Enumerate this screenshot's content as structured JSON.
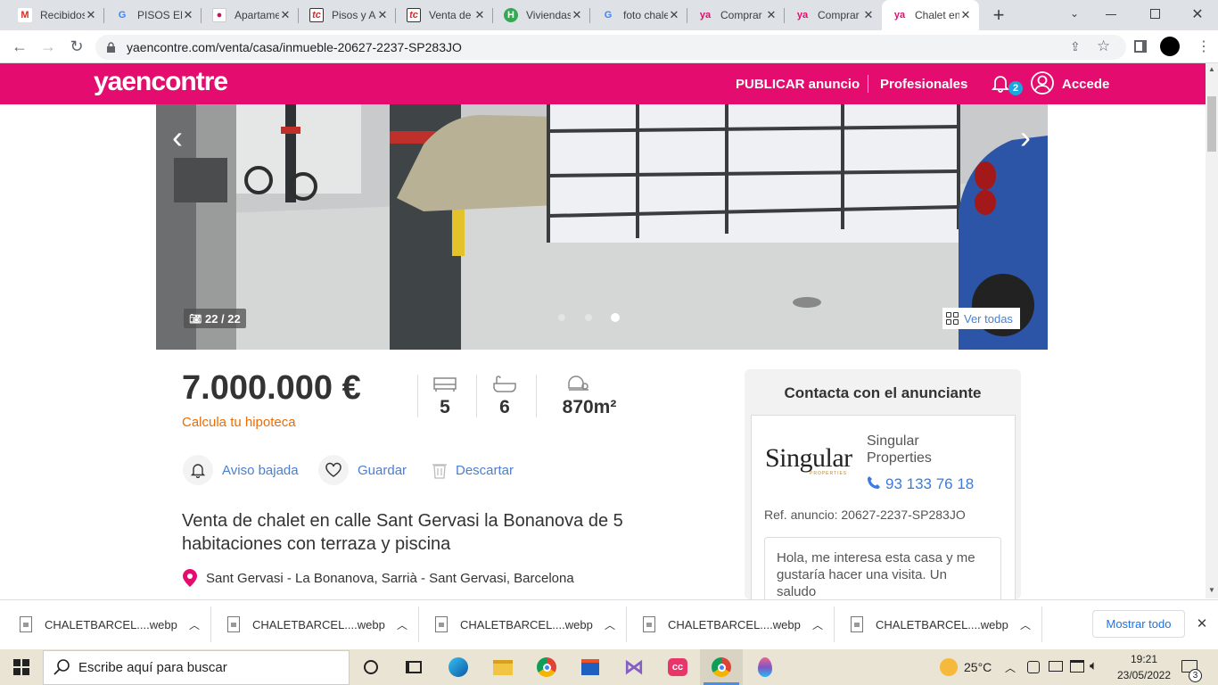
{
  "browser": {
    "tabs": [
      {
        "title": "Recibidos",
        "icon": "gmail-icon"
      },
      {
        "title": "PISOS EN",
        "icon": "google-icon"
      },
      {
        "title": "Apartamentos",
        "icon": "site-icon"
      },
      {
        "title": "Pisos y A",
        "icon": "tc-icon"
      },
      {
        "title": "Venta de",
        "icon": "tc-icon"
      },
      {
        "title": "Viviendas",
        "icon": "habitaclia-icon"
      },
      {
        "title": "foto chalet",
        "icon": "google-icon"
      },
      {
        "title": "Comprar",
        "icon": "ya-icon"
      },
      {
        "title": "Comprar",
        "icon": "ya-icon"
      },
      {
        "title": "Chalet en",
        "icon": "ya-icon"
      }
    ],
    "url": "yaencontre.com/venta/casa/inmueble-20627-2237-SP283JO",
    "fav_letters": {
      "ya": "ya",
      "tc": "tc",
      "h": "H",
      "g": "G",
      "m": "M"
    }
  },
  "site": {
    "logo": "yaencontre",
    "nav_publish": "PUBLICAR anuncio",
    "nav_pros": "Profesionales",
    "notif_count": "2",
    "nav_login": "Accede",
    "brand_color": "#e50c6f"
  },
  "gallery": {
    "counter": "22 / 22",
    "ver_todas": "Ver todas",
    "dots": 3,
    "active_dot": 3
  },
  "listing": {
    "price": "7.000.000 €",
    "mortgage_link": "Calcula tu hipoteca",
    "rooms": "5",
    "baths": "6",
    "area": "870m²",
    "actions": {
      "alert": "Aviso bajada",
      "save": "Guardar",
      "discard": "Descartar"
    },
    "title": "Venta de chalet en calle Sant Gervasi la Bonanova de 5 habitaciones con terraza y piscina",
    "location": "Sant Gervasi - La Bonanova, Sarrià - Sant Gervasi, Barcelona"
  },
  "contact": {
    "heading": "Contacta con el anunciante",
    "agency_logo": "Singular",
    "agency_logo_sub": "PROPERTIES",
    "agency_name": "Singular Properties",
    "phone": "93 133 76 18",
    "ref": "Ref. anuncio: 20627-2237-SP283JO",
    "message": "Hola, me interesa esta casa y me gustaría hacer una visita. Un saludo"
  },
  "downloads": {
    "items": [
      "CHALETBARCEL....webp",
      "CHALETBARCEL....webp",
      "CHALETBARCEL....webp",
      "CHALETBARCEL....webp",
      "CHALETBARCEL....webp"
    ],
    "show_all": "Mostrar todo"
  },
  "taskbar": {
    "search_placeholder": "Escribe aquí para buscar",
    "weather": "25°C",
    "time": "19:21",
    "date": "23/05/2022",
    "notif": "3"
  }
}
